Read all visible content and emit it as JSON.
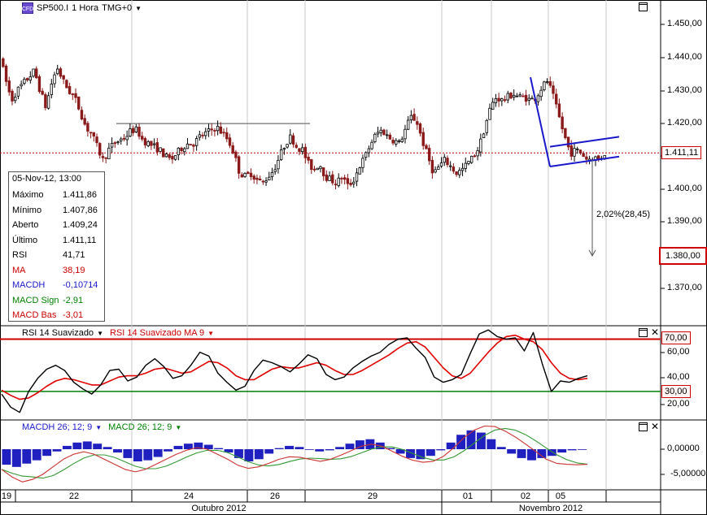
{
  "header": {
    "symbol": "SP500.I",
    "interval": "1 Hora",
    "timezone": "TMG+0"
  },
  "info_box": {
    "date": "05-Nov-12, 13:00",
    "rows": [
      {
        "label": "Máximo",
        "value": "1.411,86",
        "color": "#000000"
      },
      {
        "label": "Mínimo",
        "value": "1.407,86",
        "color": "#000000"
      },
      {
        "label": "Aberto",
        "value": "1.409,24",
        "color": "#000000"
      },
      {
        "label": "Último",
        "value": "1.411,11",
        "color": "#000000"
      },
      {
        "label": "RSI",
        "value": "41,71",
        "color": "#000000"
      },
      {
        "label": "MA",
        "value": "38,19",
        "color": "#cc0000"
      },
      {
        "label": "MACDH",
        "value": "-0,10714",
        "color": "#1a1acc"
      },
      {
        "label": "MACD Sign",
        "value": "-2,91",
        "color": "#008000"
      },
      {
        "label": "MACD Bas",
        "value": "-3,01",
        "color": "#cc0000"
      }
    ]
  },
  "price_axis": {
    "ticks": [
      "1.450,00",
      "1.440,00",
      "1.430,00",
      "1.420,00",
      "1.410,00",
      "1.400,00",
      "1.390,00",
      "1.380,00",
      "1.370,00"
    ],
    "last_price_label": "1.411,11",
    "target_label": "1.380,00"
  },
  "annotation": {
    "projection_label": "2,02%(28,45)"
  },
  "rsi_panel": {
    "title_1": "RSI 14 Suavizado",
    "title_2": "RSI 14 Suavizado MA 9",
    "ticks": [
      "60,00",
      "40,00",
      "20,00"
    ],
    "upper_band": "70,00",
    "lower_band": "30,00"
  },
  "macd_panel": {
    "title_1": "MACDH 26; 12; 9",
    "title_2": "MACD 26; 12; 9",
    "ticks": [
      "0,00000",
      "-5,00000"
    ]
  },
  "time_axis": {
    "days": [
      "19",
      "22",
      "24",
      "26",
      "29",
      "01",
      "02",
      "05"
    ],
    "months": [
      "Outubro 2012",
      "Novembro 2012"
    ]
  },
  "colors": {
    "bull": "#000000",
    "bear": "#8b1a1a",
    "rsi": "#000000",
    "rsi_ma": "#e00000",
    "band_upper": "#cc0000",
    "band_lower": "#008000",
    "macd_hist": "#2020c0",
    "macd_line": "#cc3333",
    "macd_signal": "#339933",
    "trend": "#1a1acc",
    "resistance": "#888888",
    "last_price_line": "#cc0000"
  },
  "chart_data": [
    {
      "type": "candlestick",
      "title": "SP500.I 1 Hora TMG+0",
      "x_range": [
        "2012-10-19",
        "2012-11-05"
      ],
      "ylim": [
        1360,
        1455
      ],
      "last_price": 1411.11,
      "target_price": 1380.0,
      "resistance_level": 1420,
      "anchors": [
        [
          0,
          1440
        ],
        [
          0.5,
          1433
        ],
        [
          1,
          1427
        ],
        [
          1.5,
          1430
        ],
        [
          2,
          1432
        ],
        [
          2.5,
          1434
        ],
        [
          3,
          1436
        ],
        [
          3.5,
          1430
        ],
        [
          4,
          1425
        ],
        [
          4.5,
          1432
        ],
        [
          5,
          1437
        ],
        [
          5.5,
          1433
        ],
        [
          6,
          1430
        ],
        [
          6.5,
          1428
        ],
        [
          7,
          1424
        ],
        [
          7.5,
          1419
        ],
        [
          8,
          1417
        ],
        [
          8.5,
          1413
        ],
        [
          9,
          1409
        ],
        [
          9.5,
          1412
        ],
        [
          10,
          1414
        ],
        [
          10.5,
          1415
        ],
        [
          11,
          1416
        ],
        [
          11.5,
          1418
        ],
        [
          12,
          1418
        ],
        [
          12.5,
          1415
        ],
        [
          13,
          1414
        ],
        [
          13.5,
          1413
        ],
        [
          14,
          1412
        ],
        [
          14.5,
          1410
        ],
        [
          15,
          1409
        ],
        [
          15.5,
          1411
        ],
        [
          16,
          1413
        ],
        [
          16.5,
          1414
        ],
        [
          17,
          1414
        ],
        [
          17.5,
          1416
        ],
        [
          18,
          1417
        ],
        [
          18.5,
          1418
        ],
        [
          19,
          1419
        ],
        [
          19.5,
          1417
        ],
        [
          20,
          1415
        ],
        [
          20.5,
          1411
        ],
        [
          21,
          1405
        ],
        [
          21.5,
          1404
        ],
        [
          22,
          1405
        ],
        [
          22.5,
          1403
        ],
        [
          23,
          1402
        ],
        [
          23.5,
          1404
        ],
        [
          24,
          1406
        ],
        [
          24.5,
          1410
        ],
        [
          25,
          1414
        ],
        [
          25.5,
          1416
        ],
        [
          26,
          1413
        ],
        [
          26.5,
          1412
        ],
        [
          27,
          1408
        ],
        [
          27.5,
          1406
        ],
        [
          28,
          1408
        ],
        [
          28.5,
          1404
        ],
        [
          29,
          1403
        ],
        [
          29.5,
          1402
        ],
        [
          30,
          1404
        ],
        [
          30.5,
          1401
        ],
        [
          31,
          1403
        ],
        [
          31.5,
          1407
        ],
        [
          32,
          1410
        ],
        [
          32.5,
          1414
        ],
        [
          33,
          1417
        ],
        [
          33.5,
          1418
        ],
        [
          34,
          1416
        ],
        [
          34.5,
          1415
        ],
        [
          35,
          1414
        ],
        [
          35.5,
          1418
        ],
        [
          36,
          1422
        ],
        [
          36.5,
          1421
        ],
        [
          37,
          1415
        ],
        [
          37.5,
          1410
        ],
        [
          38,
          1405
        ],
        [
          38.5,
          1407
        ],
        [
          39,
          1409
        ],
        [
          39.5,
          1407
        ],
        [
          40,
          1405
        ],
        [
          40.5,
          1406
        ],
        [
          41,
          1408
        ],
        [
          41.5,
          1410
        ],
        [
          42,
          1413
        ],
        [
          42.5,
          1419
        ],
        [
          43,
          1425
        ],
        [
          43.5,
          1428
        ],
        [
          44,
          1427
        ],
        [
          44.5,
          1428
        ],
        [
          45,
          1429
        ],
        [
          45.5,
          1428
        ],
        [
          46,
          1428
        ],
        [
          46.5,
          1427
        ],
        [
          47,
          1428
        ],
        [
          47.5,
          1431
        ],
        [
          48,
          1433
        ],
        [
          48.5,
          1428
        ],
        [
          49,
          1422
        ],
        [
          49.5,
          1416
        ],
        [
          50,
          1411
        ],
        [
          50.5,
          1412
        ],
        [
          51,
          1411
        ],
        [
          51.5,
          1409
        ],
        [
          52,
          1410
        ],
        [
          52.5,
          1409
        ],
        [
          53,
          1411
        ]
      ]
    },
    {
      "type": "line",
      "title": "RSI 14 Suavizado",
      "ylim": [
        5,
        80
      ],
      "bands": [
        70,
        30
      ],
      "series": [
        {
          "name": "RSI 14 Suavizado",
          "values": [
            28,
            18,
            14,
            30,
            40,
            47,
            50,
            46,
            37,
            32,
            28,
            35,
            46,
            47,
            38,
            41,
            50,
            55,
            49,
            40,
            42,
            50,
            60,
            57,
            44,
            37,
            31,
            34,
            46,
            54,
            52,
            49,
            45,
            51,
            58,
            55,
            43,
            39,
            41,
            48,
            53,
            57,
            60,
            66,
            70,
            71,
            63,
            56,
            41,
            37,
            39,
            43,
            59,
            74,
            77,
            72,
            70,
            71,
            61,
            75,
            51,
            30,
            38,
            37,
            40,
            42
          ]
        },
        {
          "name": "RSI 14 Suavizado MA 9",
          "values": [
            31,
            27,
            24,
            25,
            29,
            34,
            38,
            40,
            39,
            37,
            35,
            35,
            38,
            41,
            42,
            42,
            44,
            47,
            48,
            46,
            44,
            45,
            49,
            53,
            52,
            48,
            42,
            39,
            39,
            43,
            47,
            49,
            48,
            48,
            50,
            52,
            50,
            46,
            43,
            43,
            46,
            50,
            54,
            58,
            63,
            67,
            68,
            64,
            56,
            48,
            42,
            40,
            44,
            52,
            60,
            67,
            72,
            73,
            70,
            68,
            62,
            52,
            44,
            40,
            39,
            40
          ]
        }
      ]
    },
    {
      "type": "bar",
      "title": "MACDH 26; 12; 9",
      "ylim": [
        -8,
        6
      ],
      "series": [
        {
          "name": "MACDH 26; 12; 9",
          "values": [
            -1.4,
            -1.6,
            -1.3,
            -1.0,
            -0.6,
            -0.2,
            0.3,
            0.6,
            0.7,
            0.5,
            0.2,
            -0.3,
            -0.8,
            -1.1,
            -1.0,
            -0.7,
            -0.2,
            0.3,
            0.5,
            0.6,
            0.4,
            0.1,
            -0.3,
            -0.8,
            -1.1,
            -0.9,
            -0.4,
            0.1,
            0.3,
            0.2,
            0,
            -0.2,
            -0.1,
            0.2,
            0.5,
            0.8,
            0.9,
            0.6,
            0.1,
            -0.4,
            -0.8,
            -0.9,
            -0.6,
            -0.1,
            0.6,
            1.3,
            1.7,
            1.5,
            0.9,
            0.2,
            -0.4,
            -0.8,
            -1.0,
            -0.8,
            -0.6,
            -0.3,
            -0.1,
            0
          ]
        },
        {
          "name": "MACD 26; 12; 9",
          "values": [
            -4,
            -5.5,
            -6.5,
            -6,
            -5,
            -3.5,
            -2,
            -1,
            -0.5,
            -1,
            -2,
            -3,
            -4,
            -4.5,
            -4,
            -3,
            -2,
            -1,
            -0.2,
            0.3,
            0,
            -1,
            -2,
            -3.2,
            -3.8,
            -3.5,
            -2.8,
            -2,
            -1.5,
            -1.6,
            -2,
            -2.4,
            -2,
            -1.2,
            -0.3,
            0.6,
            1,
            0.6,
            -0.4,
            -1.4,
            -2.2,
            -2.6,
            -2.4,
            -1.4,
            0.3,
            2.3,
            3.8,
            4.6,
            4.5,
            3.6,
            2.4,
            1,
            -0.5,
            -2,
            -2.8,
            -3,
            -3.1,
            -3
          ]
        }
      ]
    }
  ]
}
